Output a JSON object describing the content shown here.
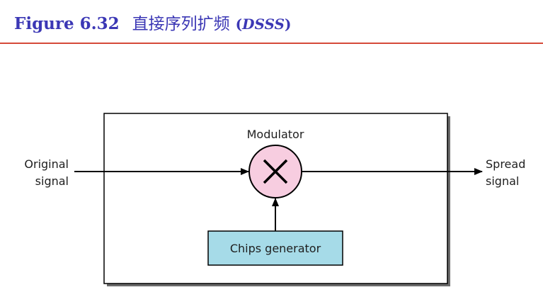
{
  "header": {
    "figure_number": "Figure 6.32",
    "title_zh": "直接序列扩频",
    "paren_open": "(",
    "title_abbr": "DSSS",
    "paren_close": ")"
  },
  "diagram": {
    "input_label": [
      "Original",
      "signal"
    ],
    "output_label": [
      "Spread",
      "signal"
    ],
    "modulator_label": "Modulator",
    "generator_label": "Chips generator",
    "colors": {
      "modulator_fill": "#f7cde0",
      "generator_fill": "#a6dbe8",
      "line": "#000000",
      "title": "#3b37b5",
      "rule": "#d54a3a"
    }
  }
}
